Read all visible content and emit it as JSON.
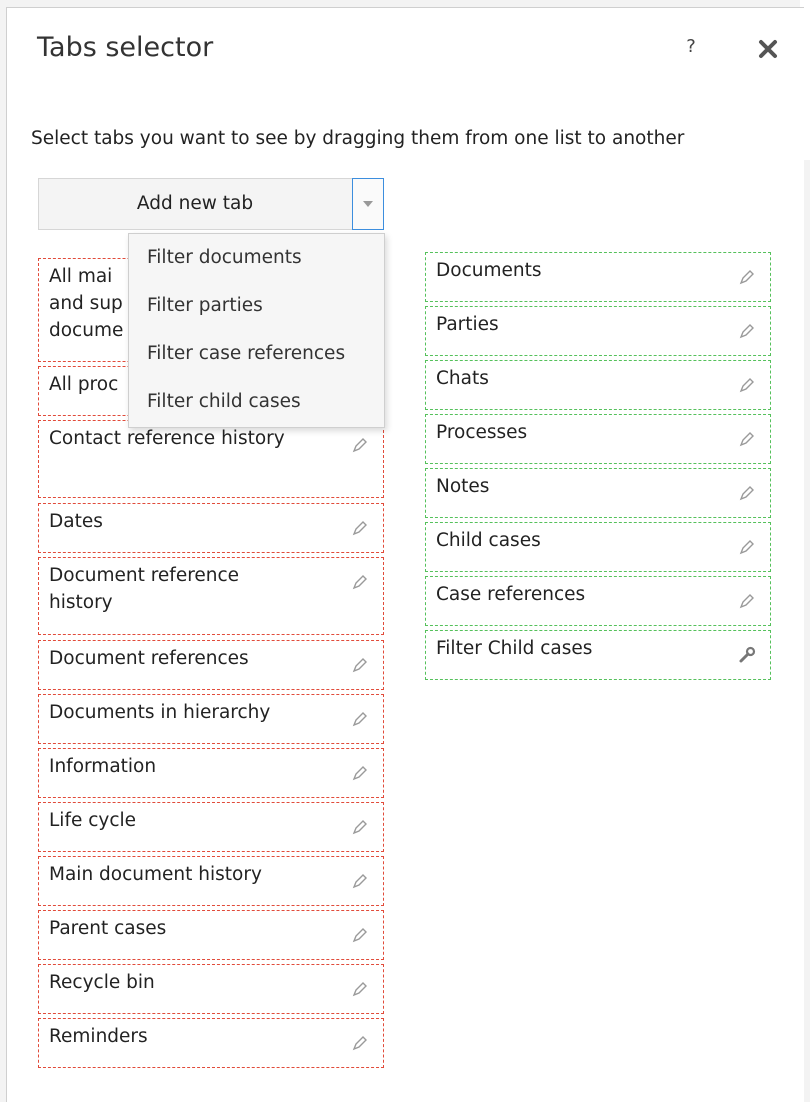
{
  "dialog": {
    "title": "Tabs selector",
    "help_label": "?",
    "instructions": "Select tabs you want to see by dragging them from one list to another"
  },
  "add_tab": {
    "label": "Add new tab",
    "options": [
      "Filter documents",
      "Filter parties",
      "Filter case references",
      "Filter child cases"
    ]
  },
  "available_tabs": [
    {
      "label": "All main and supporting documents",
      "visible_text": [
        "All mai",
        "and sup",
        "docume"
      ]
    },
    {
      "label": "All processes",
      "visible_text": [
        "All proc"
      ]
    },
    {
      "label": "Contact reference history"
    },
    {
      "label": "Dates"
    },
    {
      "label": "Document reference history"
    },
    {
      "label": "Document references"
    },
    {
      "label": "Documents in hierarchy"
    },
    {
      "label": "Information"
    },
    {
      "label": "Life cycle"
    },
    {
      "label": "Main document history"
    },
    {
      "label": "Parent cases"
    },
    {
      "label": "Recycle bin"
    },
    {
      "label": "Reminders"
    }
  ],
  "selected_tabs": [
    {
      "label": "Documents",
      "icon": "pencil-icon"
    },
    {
      "label": "Parties",
      "icon": "pencil-icon"
    },
    {
      "label": "Chats",
      "icon": "pencil-icon"
    },
    {
      "label": "Processes",
      "icon": "pencil-icon"
    },
    {
      "label": "Notes",
      "icon": "pencil-icon"
    },
    {
      "label": "Child cases",
      "icon": "pencil-icon"
    },
    {
      "label": "Case references",
      "icon": "pencil-icon"
    },
    {
      "label": "Filter Child cases",
      "icon": "wrench-icon"
    }
  ],
  "colors": {
    "available_border": "#e14b3a",
    "selected_border": "#55c15b",
    "focus_border": "#3c8ede"
  }
}
